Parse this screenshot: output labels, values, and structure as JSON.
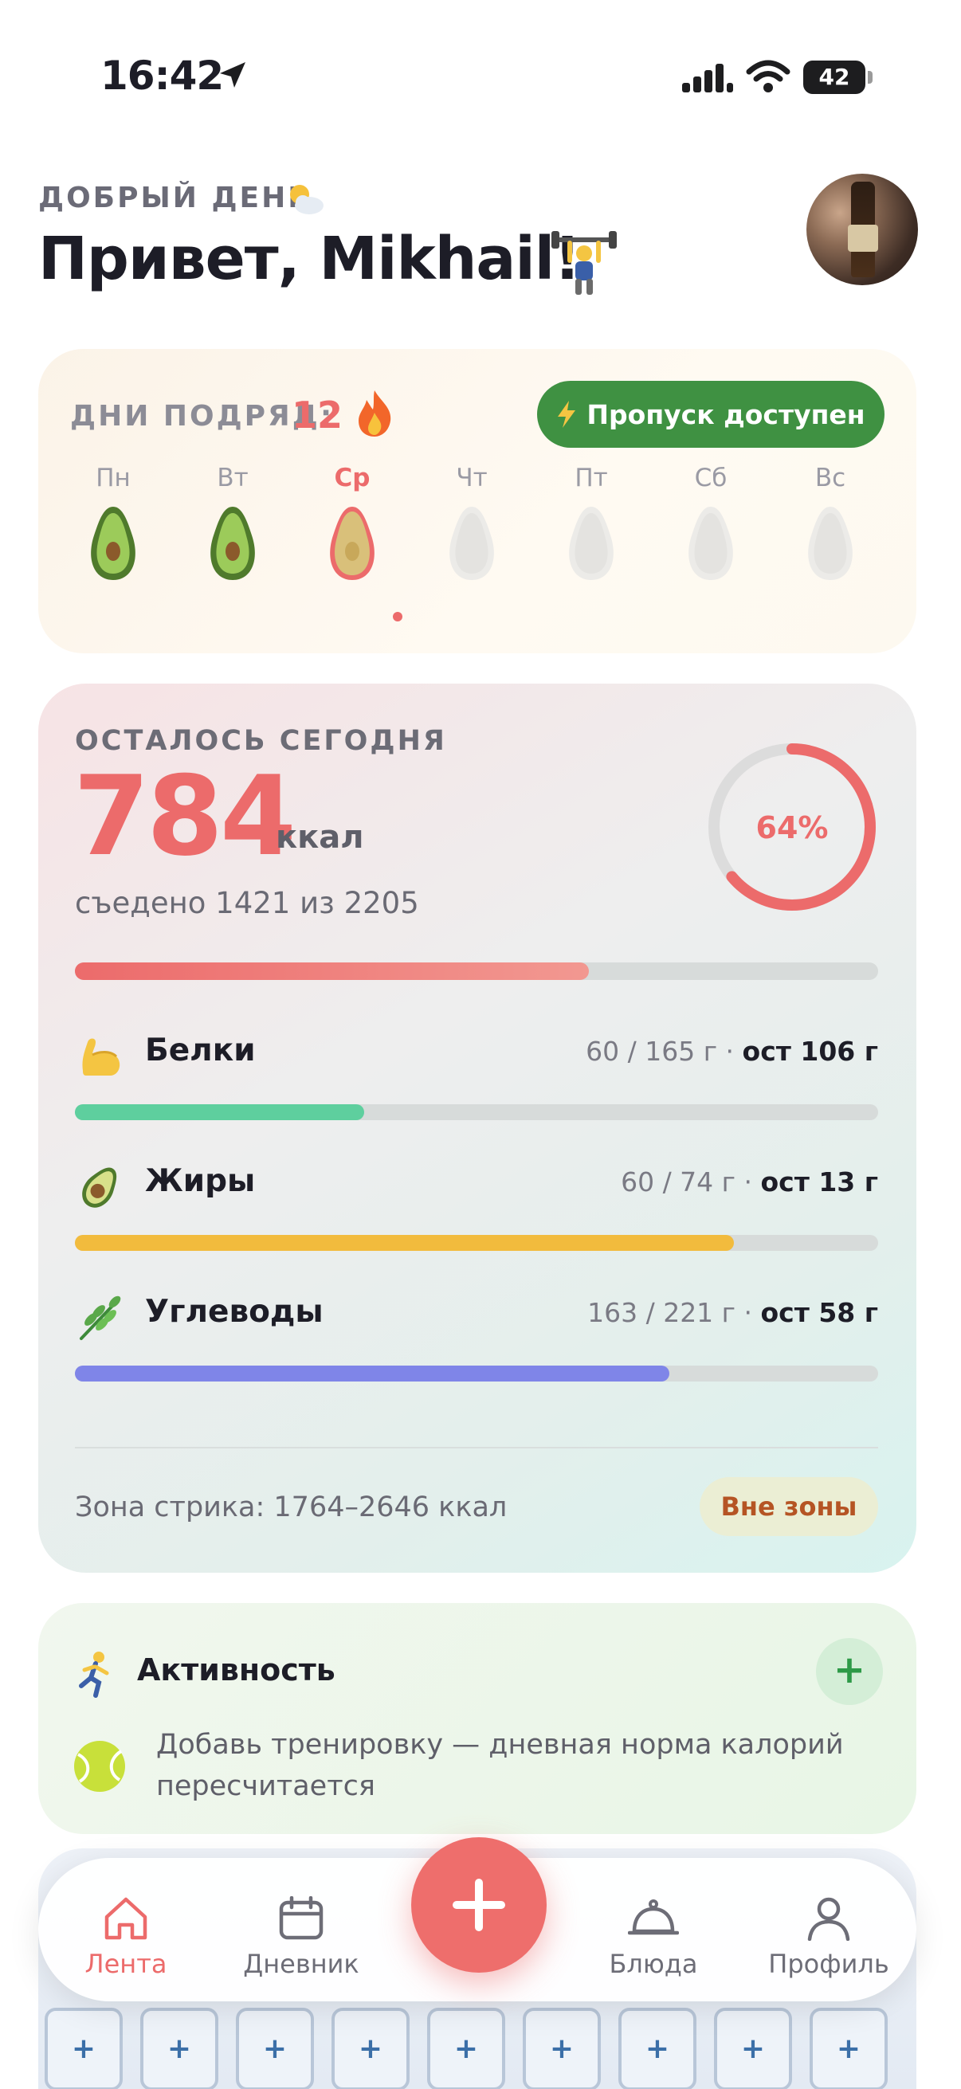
{
  "status_bar": {
    "time": "16:42",
    "battery": "42"
  },
  "greeting": {
    "subtitle": "ДОБРЫЙ ДЕНЬ",
    "title": "Привет, Mikhail!"
  },
  "streak": {
    "label": "ДНИ ПОДРЯД:",
    "count": "12",
    "skip_label": "Пропуск доступен",
    "days": [
      {
        "name": "Пн",
        "state": "done"
      },
      {
        "name": "Вт",
        "state": "done"
      },
      {
        "name": "Ср",
        "state": "today"
      },
      {
        "name": "Чт",
        "state": "future"
      },
      {
        "name": "Пт",
        "state": "future"
      },
      {
        "name": "Сб",
        "state": "future"
      },
      {
        "name": "Вс",
        "state": "future"
      }
    ]
  },
  "calories": {
    "label": "ОСТАЛОСЬ СЕГОДНЯ",
    "remaining": "784",
    "unit": "ккал",
    "eaten_text": "съедено 1421 из 2205",
    "percent_text": "64%",
    "progress": 0.64
  },
  "macros": [
    {
      "name": "Белки",
      "stat": "60 / 165 г · ",
      "left": "ост 106 г",
      "progress": 0.36,
      "color": "#5ecf9e",
      "icon": "flexed-biceps-icon"
    },
    {
      "name": "Жиры",
      "stat": "60 / 74 г · ",
      "left": "ост 13 г",
      "progress": 0.82,
      "color": "#f2bb3d",
      "icon": "avocado-icon"
    },
    {
      "name": "Углеводы",
      "stat": "163 / 221 г · ",
      "left": "ост 58 г",
      "progress": 0.74,
      "color": "#7f85e8",
      "icon": "herb-icon"
    }
  ],
  "zone": {
    "text": "Зона стрика: 1764–2646 ккал",
    "badge": "Вне зоны"
  },
  "activity": {
    "title": "Активность",
    "text": "Добавь тренировку — дневная норма калорий пересчитается",
    "add_label": "+"
  },
  "nav": {
    "items": [
      {
        "label": "Лента",
        "icon": "home-icon",
        "active": true
      },
      {
        "label": "Дневник",
        "icon": "calendar-icon",
        "active": false
      },
      {
        "label": "Блюда",
        "icon": "cloche-icon",
        "active": false
      },
      {
        "label": "Профиль",
        "icon": "person-icon",
        "active": false
      }
    ],
    "grid_cells": [
      "+",
      "+",
      "+",
      "+",
      "+",
      "+",
      "+",
      "+",
      "+"
    ]
  },
  "colors": {
    "accent": "#ec6b6b",
    "green": "#3f9142"
  }
}
